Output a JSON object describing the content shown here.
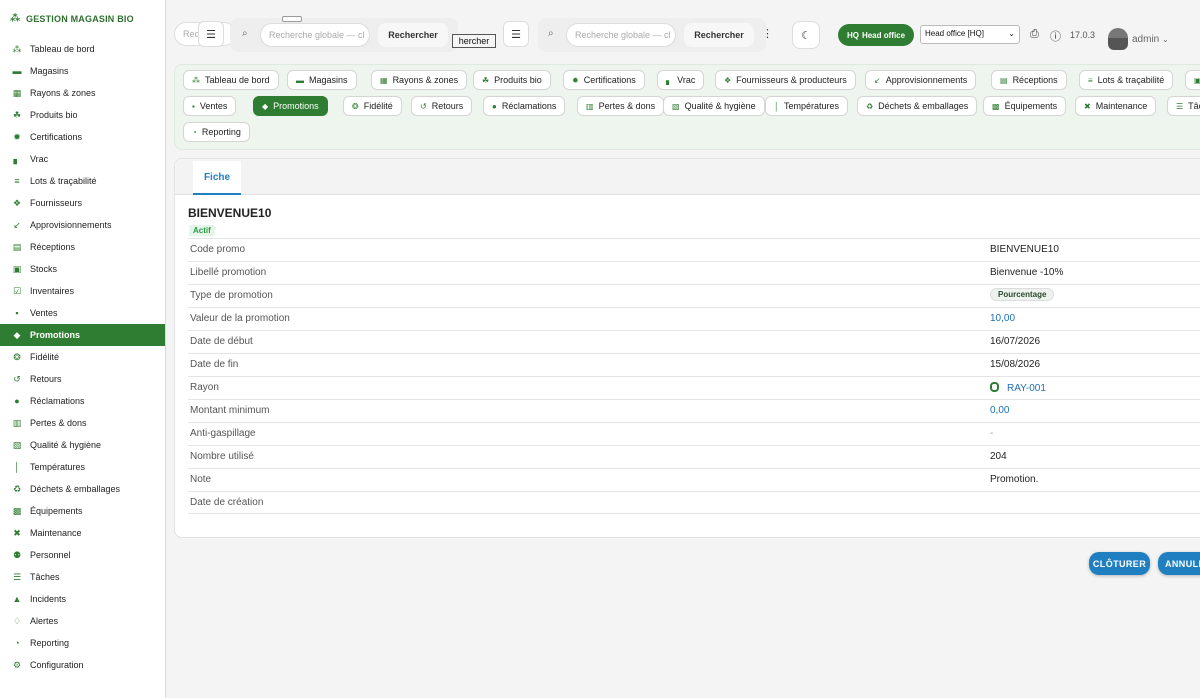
{
  "app": {
    "brand": "GESTION MAGASIN BIO"
  },
  "sidebar": {
    "items": [
      {
        "label": "Tableau de bord",
        "icon": "seedling-icon",
        "glyph": "⁂"
      },
      {
        "label": "Magasins",
        "icon": "store-icon",
        "glyph": "▬"
      },
      {
        "label": "Rayons & zones",
        "icon": "grid-icon",
        "glyph": "▦"
      },
      {
        "label": "Produits bio",
        "icon": "leaf-icon",
        "glyph": "☘"
      },
      {
        "label": "Certifications",
        "icon": "certificate-icon",
        "glyph": "✹"
      },
      {
        "label": "Vrac",
        "icon": "bulk-icon",
        "glyph": "▖"
      },
      {
        "label": "Lots & traçabilité",
        "icon": "list-icon",
        "glyph": "≡"
      },
      {
        "label": "Fournisseurs",
        "icon": "supplier-icon",
        "glyph": "❖"
      },
      {
        "label": "Approvisionnements",
        "icon": "supply-icon",
        "glyph": "↙"
      },
      {
        "label": "Réceptions",
        "icon": "truck-icon",
        "glyph": "▤"
      },
      {
        "label": "Stocks",
        "icon": "warehouse-icon",
        "glyph": "▣"
      },
      {
        "label": "Inventaires",
        "icon": "clipboard-check-icon",
        "glyph": "☑"
      },
      {
        "label": "Ventes",
        "icon": "cash-register-icon",
        "glyph": "▪"
      },
      {
        "label": "Promotions",
        "icon": "tags-icon",
        "glyph": "◆"
      },
      {
        "label": "Fidélité",
        "icon": "award-icon",
        "glyph": "❂"
      },
      {
        "label": "Retours",
        "icon": "undo-icon",
        "glyph": "↺"
      },
      {
        "label": "Réclamations",
        "icon": "comment-icon",
        "glyph": "●"
      },
      {
        "label": "Pertes & dons",
        "icon": "trash-icon",
        "glyph": "▥"
      },
      {
        "label": "Qualité & hygiène",
        "icon": "clipboard-icon",
        "glyph": "▧"
      },
      {
        "label": "Températures",
        "icon": "thermometer-icon",
        "glyph": "│"
      },
      {
        "label": "Déchets & emballages",
        "icon": "recycle-icon",
        "glyph": "♻"
      },
      {
        "label": "Équipements",
        "icon": "equipment-icon",
        "glyph": "▩"
      },
      {
        "label": "Maintenance",
        "icon": "tools-icon",
        "glyph": "✖"
      },
      {
        "label": "Personnel",
        "icon": "users-icon",
        "glyph": "⚉"
      },
      {
        "label": "Tâches",
        "icon": "tasks-icon",
        "glyph": "☰"
      },
      {
        "label": "Incidents",
        "icon": "warning-icon",
        "glyph": "▲"
      },
      {
        "label": "Alertes",
        "icon": "bell-icon",
        "glyph": "♢"
      },
      {
        "label": "Reporting",
        "icon": "chart-pie-icon",
        "glyph": "◔"
      },
      {
        "label": "Configuration",
        "icon": "gear-icon",
        "glyph": "⚙"
      }
    ],
    "active_index": 13
  },
  "topbar": {
    "ghost_search_placeholder": "Rech",
    "ghost_button_label": "Rechercher",
    "search1": {
      "placeholder": "Recherche globale — cl",
      "button": "Rechercher"
    },
    "search2": {
      "placeholder": "Recherche globale — cl",
      "button": "Rechercher"
    },
    "tooltip_button": "hercher",
    "hq_badge": "HQ",
    "hq_badge_label": "Head office",
    "office_select_value": "Head office [HQ]",
    "version": "17.0.3",
    "user": "admin"
  },
  "modules": {
    "items": [
      {
        "label": "Tableau de bord",
        "icon": "seedling-icon",
        "glyph": "⁂"
      },
      {
        "label": "Magasins",
        "icon": "store-icon",
        "glyph": "▬"
      },
      {
        "label": "Rayons & zones",
        "icon": "grid-icon",
        "glyph": "▦"
      },
      {
        "label": "Produits bio",
        "icon": "leaf-icon",
        "glyph": "☘"
      },
      {
        "label": "Certifications",
        "icon": "certificate-icon",
        "glyph": "✹"
      },
      {
        "label": "Vrac",
        "icon": "bulk-icon",
        "glyph": "▖"
      },
      {
        "label": "Fournisseurs & producteurs",
        "icon": "supplier-icon",
        "glyph": "❖"
      },
      {
        "label": "Approvisionnements",
        "icon": "supply-icon",
        "glyph": "↙"
      },
      {
        "label": "Réceptions",
        "icon": "truck-icon",
        "glyph": "▤"
      },
      {
        "label": "Lots & traçabilité",
        "icon": "list-icon",
        "glyph": "≡"
      },
      {
        "label": "Stocks",
        "icon": "warehouse-icon",
        "glyph": "▣"
      },
      {
        "label": "Ventes",
        "icon": "cash-register-icon",
        "glyph": "▪"
      },
      {
        "label": "Promotions",
        "icon": "tags-icon",
        "glyph": "◆"
      },
      {
        "label": "Fidélité",
        "icon": "award-icon",
        "glyph": "❂"
      },
      {
        "label": "Retours",
        "icon": "undo-icon",
        "glyph": "↺"
      },
      {
        "label": "Réclamations",
        "icon": "comment-icon",
        "glyph": "●"
      },
      {
        "label": "Pertes & dons",
        "icon": "trash-icon",
        "glyph": "▥"
      },
      {
        "label": "Qualité & hygiène",
        "icon": "clipboard-icon",
        "glyph": "▧"
      },
      {
        "label": "Températures",
        "icon": "thermometer-icon",
        "glyph": "│"
      },
      {
        "label": "Déchets & emballages",
        "icon": "recycle-icon",
        "glyph": "♻"
      },
      {
        "label": "Équipements",
        "icon": "equipment-icon",
        "glyph": "▩"
      },
      {
        "label": "Maintenance",
        "icon": "tools-icon",
        "glyph": "✖"
      },
      {
        "label": "Tâches",
        "icon": "tasks-icon",
        "glyph": "☰"
      },
      {
        "label": "Reporting",
        "icon": "chart-pie-icon",
        "glyph": "◔"
      }
    ],
    "active_index": 12
  },
  "record": {
    "tab": "Fiche",
    "title": "BIENVENUE10",
    "status": "Actif",
    "fields": [
      {
        "label": "Code promo",
        "value": "BIENVENUE10",
        "kind": "text"
      },
      {
        "label": "Libellé promotion",
        "value": "Bienvenue -10%",
        "kind": "text"
      },
      {
        "label": "Type de promotion",
        "value": "Pourcentage",
        "kind": "pill"
      },
      {
        "label": "Valeur de la promotion",
        "value": "10,00",
        "kind": "link"
      },
      {
        "label": "Date de début",
        "value": "16/07/2026",
        "kind": "text"
      },
      {
        "label": "Date de fin",
        "value": "15/08/2026",
        "kind": "text"
      },
      {
        "label": "Rayon",
        "value": "RAY-001",
        "kind": "rayon"
      },
      {
        "label": "Montant minimum",
        "value": "0,00",
        "kind": "link"
      },
      {
        "label": "Anti-gaspillage",
        "value": "-",
        "kind": "muted"
      },
      {
        "label": "Nombre utilisé",
        "value": "204",
        "kind": "text"
      },
      {
        "label": "Note",
        "value": "Promotion.",
        "kind": "text"
      },
      {
        "label": "Date de création",
        "value": "",
        "kind": "text"
      }
    ]
  },
  "actions": {
    "close": "CLÔTURER",
    "cancel": "ANNULE"
  },
  "colors": {
    "brand_green": "#2f7d32",
    "link_blue": "#1f6fb3",
    "button_blue": "#1f7fc1"
  }
}
